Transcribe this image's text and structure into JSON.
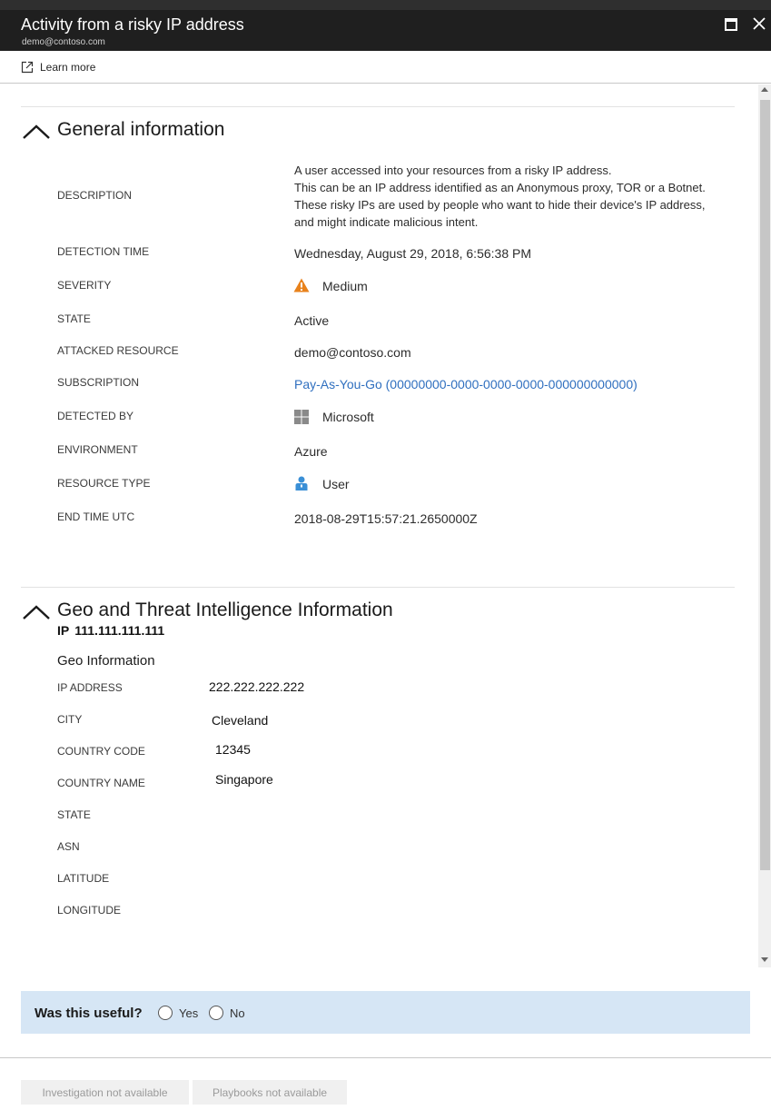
{
  "window": {
    "title": "Activity from a risky IP address",
    "subtitle": "demo@contoso.com"
  },
  "toolbar": {
    "learn_more": "Learn more"
  },
  "general": {
    "title": "General information",
    "rows": {
      "description": {
        "label": "DESCRIPTION",
        "lines": [
          "A user accessed into your resources from a risky IP address.",
          "This can be an IP address identified as an Anonymous proxy, TOR or a Botnet.",
          "These risky IPs are used by people who want to hide their device's IP address,",
          "and might indicate malicious intent."
        ]
      },
      "detection_time": {
        "label": "DETECTION TIME",
        "value": "Wednesday, August 29, 2018, 6:56:38 PM"
      },
      "severity": {
        "label": "SEVERITY",
        "value": "Medium",
        "icon": "warning-icon",
        "color": "#e8821c"
      },
      "state": {
        "label": "STATE",
        "value": "Active"
      },
      "attacked_resource": {
        "label": "ATTACKED RESOURCE",
        "value": "demo@contoso.com"
      },
      "subscription": {
        "label": "SUBSCRIPTION",
        "value": "Pay-As-You-Go (00000000-0000-0000-0000-000000000000)"
      },
      "detected_by": {
        "label": "DETECTED BY",
        "value": "Microsoft",
        "icon": "microsoft-logo-icon"
      },
      "environment": {
        "label": "ENVIRONMENT",
        "value": "Azure"
      },
      "resource_type": {
        "label": "RESOURCE TYPE",
        "value": "User",
        "icon": "user-icon"
      },
      "end_time": {
        "label": "END TIME UTC",
        "value": "2018-08-29T15:57:21.2650000Z"
      }
    }
  },
  "geo": {
    "title": "Geo and Threat Intelligence Information",
    "ip_prefix": "IP",
    "ip": "111.111.111.111",
    "geo_info_title": "Geo Information",
    "rows": {
      "ip_address": {
        "label": "IP ADDRESS",
        "value": "222.222.222.222"
      },
      "city": {
        "label": "CITY",
        "value": "Cleveland"
      },
      "country_code": {
        "label": "COUNTRY CODE",
        "value": "12345"
      },
      "country_name": {
        "label": "COUNTRY NAME",
        "value": "Singapore"
      },
      "state": {
        "label": "STATE",
        "value": ""
      },
      "asn": {
        "label": "ASN",
        "value": ""
      },
      "latitude": {
        "label": "LATITUDE",
        "value": ""
      },
      "longitude": {
        "label": "LONGITUDE",
        "value": ""
      }
    }
  },
  "feedback": {
    "question": "Was this useful?",
    "yes": "Yes",
    "no": "No"
  },
  "footer": {
    "investigation": "Investigation not available",
    "playbooks": "Playbooks not available"
  },
  "colors": {
    "titlebar": "#1f1f1f",
    "link": "#2f6fbf",
    "feedback_bg": "#d6e6f5",
    "warning": "#e8821c",
    "user_icon": "#3a8fd6"
  }
}
